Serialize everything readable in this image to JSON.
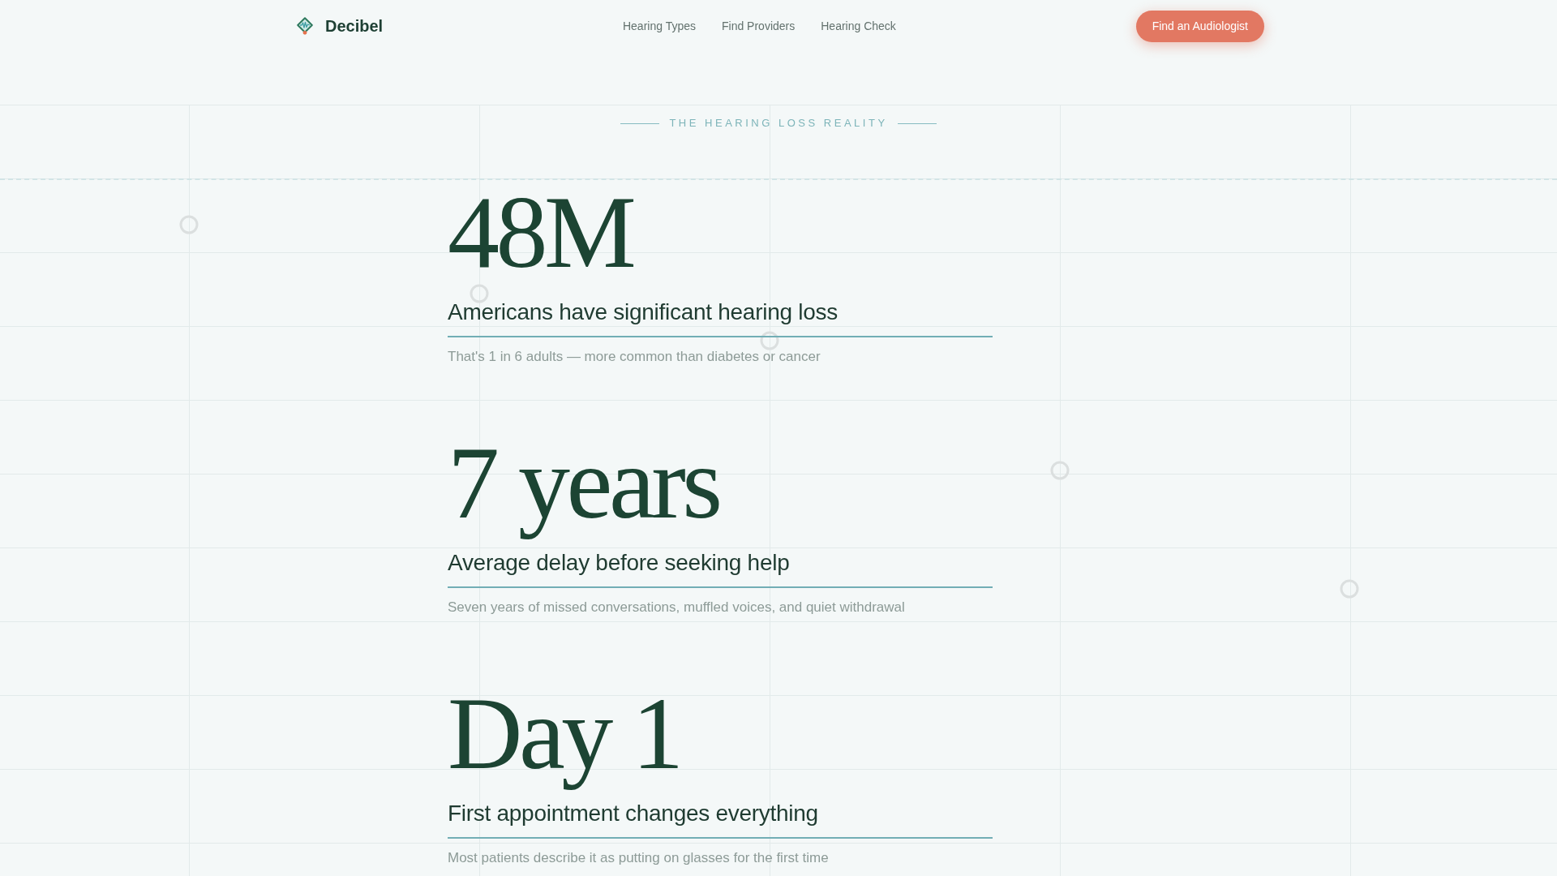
{
  "nav": {
    "brand": "Decibel",
    "links": [
      {
        "label": "Hearing Types"
      },
      {
        "label": "Find Providers"
      },
      {
        "label": "Hearing Check"
      }
    ],
    "cta": "Find an Audiologist"
  },
  "section": {
    "eyebrow": "THE HEARING LOSS REALITY"
  },
  "stats": [
    {
      "figure": "48M",
      "label": "Americans have significant hearing loss",
      "detail": "That's 1 in 6 adults — more common than diabetes or cancer"
    },
    {
      "figure": "7 years",
      "label": "Average delay before seeking help",
      "detail": "Seven years of missed conversations, muffled voices, and quiet withdrawal"
    },
    {
      "figure": "Day 1",
      "label": "First appointment changes everything",
      "detail": "Most patients describe it as putting on glasses for the first time"
    }
  ]
}
